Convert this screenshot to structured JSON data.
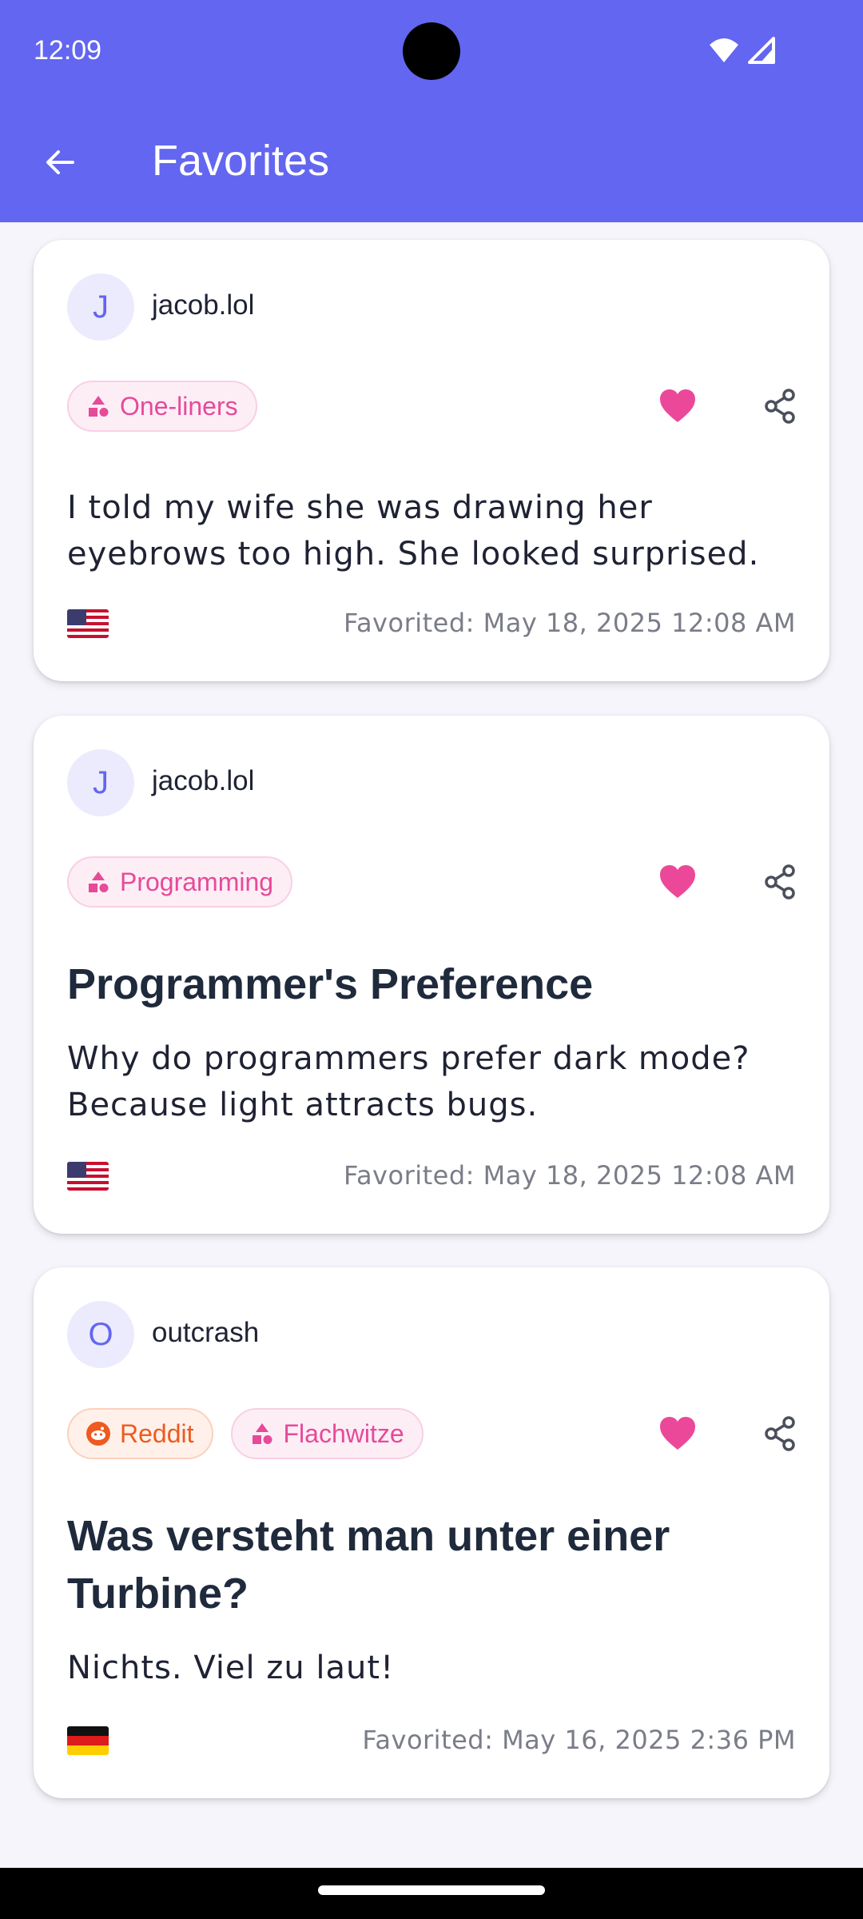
{
  "status_bar": {
    "time": "12:09"
  },
  "app_bar": {
    "title": "Favorites"
  },
  "favorites": [
    {
      "avatar_letter": "J",
      "username": "jacob.lol",
      "tags": [
        {
          "type": "category",
          "label": "One-liners"
        }
      ],
      "title": "",
      "text": "I told my wife she was drawing her eyebrows too high. She looked surprised.",
      "flag": "us-flag",
      "favorited": "Favorited: May 18, 2025 12:08 AM"
    },
    {
      "avatar_letter": "J",
      "username": "jacob.lol",
      "tags": [
        {
          "type": "category",
          "label": "Programming"
        }
      ],
      "title": "Programmer's Preference",
      "text": "Why do programmers prefer dark mode? Because light attracts bugs.",
      "flag": "us-flag",
      "favorited": "Favorited: May 18, 2025 12:08 AM"
    },
    {
      "avatar_letter": "O",
      "username": "outcrash",
      "tags": [
        {
          "type": "source",
          "label": "Reddit"
        },
        {
          "type": "category",
          "label": "Flachwitze"
        }
      ],
      "title": "Was versteht man unter einer Turbine?",
      "text": "Nichts. Viel zu laut!",
      "flag": "de-flag",
      "favorited": "Favorited: May 16, 2025 2:36 PM"
    }
  ],
  "colors": {
    "primary": "#6366f0",
    "heart": "#ec4899",
    "category_tag": "#e64a99",
    "reddit_tag": "#ee5a1f"
  }
}
